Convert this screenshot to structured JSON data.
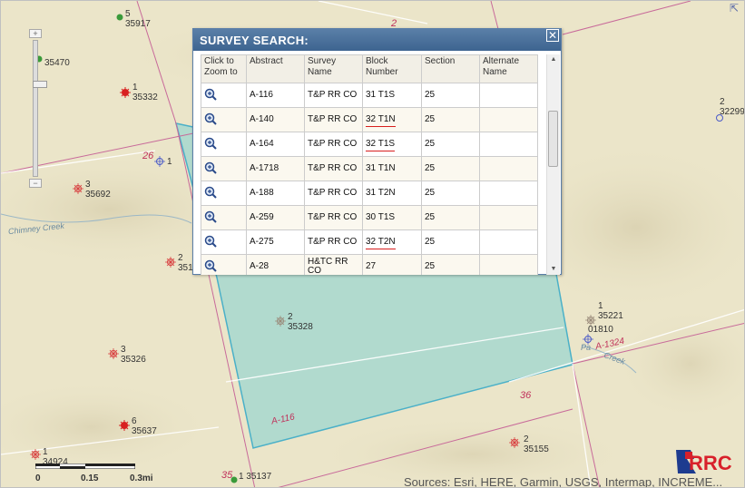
{
  "map": {
    "wells": [
      {
        "id": "w1",
        "top": "5",
        "bottom": "35917",
        "kind": "green"
      },
      {
        "id": "w2",
        "top": "",
        "bottom": "35470",
        "kind": "green"
      },
      {
        "id": "w3",
        "top": "1",
        "bottom": "35332",
        "kind": "red"
      },
      {
        "id": "w4",
        "top": "3",
        "bottom": "35692",
        "kind": "redo"
      },
      {
        "id": "w5",
        "top": "2",
        "bottom": "351",
        "kind": "redo"
      },
      {
        "id": "w6",
        "top": "2",
        "bottom": "35328",
        "kind": "grey"
      },
      {
        "id": "w7",
        "top": "3",
        "bottom": "35326",
        "kind": "redo"
      },
      {
        "id": "w8",
        "top": "6",
        "bottom": "35637",
        "kind": "red"
      },
      {
        "id": "w9",
        "top": "1",
        "bottom": "34924",
        "kind": "redo"
      },
      {
        "id": "w10",
        "top": "1",
        "bottom": "35137",
        "kind": "green"
      },
      {
        "id": "w11",
        "top": "2",
        "bottom": "35155",
        "kind": "redo"
      },
      {
        "id": "w12",
        "top": "1",
        "bottom": "35221",
        "kind": "grey"
      },
      {
        "id": "w13",
        "top": "2",
        "bottom": "32299",
        "kind": "blue"
      },
      {
        "id": "w14",
        "top": "1",
        "bottom": "",
        "kind": "blue"
      }
    ],
    "labels": {
      "section_26": "26",
      "section_2_top": "2",
      "section_36": "36",
      "section_35": "35",
      "abstract_a116": "A-116",
      "abstract_a1324": "A-1324",
      "well_01810": "01810",
      "creek_chimney": "Chimney Creek",
      "creek_pa": "Pa",
      "creek_creek": "Creek"
    },
    "scale": {
      "t0": "0",
      "t1": "0.15",
      "t2": "0.3mi"
    },
    "attribution": "Sources: Esri, HERE, Garmin, USGS, Intermap, INCREME...",
    "logo_text": "RRC",
    "zoom": {
      "plus": "+",
      "minus": "−"
    }
  },
  "dialog": {
    "title": "SURVEY SEARCH:",
    "close": "✕",
    "columns": [
      "Click to Zoom to",
      "Abstract",
      "Survey Name",
      "Block Number",
      "Section",
      "Alternate Name"
    ],
    "rows": [
      {
        "abstract": "A-116",
        "survey": "T&P RR CO",
        "block": "31 T1S",
        "section": "25",
        "alt": ""
      },
      {
        "abstract": "A-140",
        "survey": "T&P RR CO",
        "block": "32 T1N",
        "section": "25",
        "alt": ""
      },
      {
        "abstract": "A-164",
        "survey": "T&P RR CO",
        "block": "32 T1S",
        "section": "25",
        "alt": ""
      },
      {
        "abstract": "A-1718",
        "survey": "T&P RR CO",
        "block": "31 T1N",
        "section": "25",
        "alt": ""
      },
      {
        "abstract": "A-188",
        "survey": "T&P RR CO",
        "block": "31 T2N",
        "section": "25",
        "alt": ""
      },
      {
        "abstract": "A-259",
        "survey": "T&P RR CO",
        "block": "30 T1S",
        "section": "25",
        "alt": ""
      },
      {
        "abstract": "A-275",
        "survey": "T&P RR CO",
        "block": "32 T2N",
        "section": "25",
        "alt": ""
      },
      {
        "abstract": "A-28",
        "survey": "H&TC RR CO",
        "block": "27",
        "section": "25",
        "alt": ""
      }
    ],
    "scroll": {
      "up": "▲",
      "down": "▼"
    }
  }
}
